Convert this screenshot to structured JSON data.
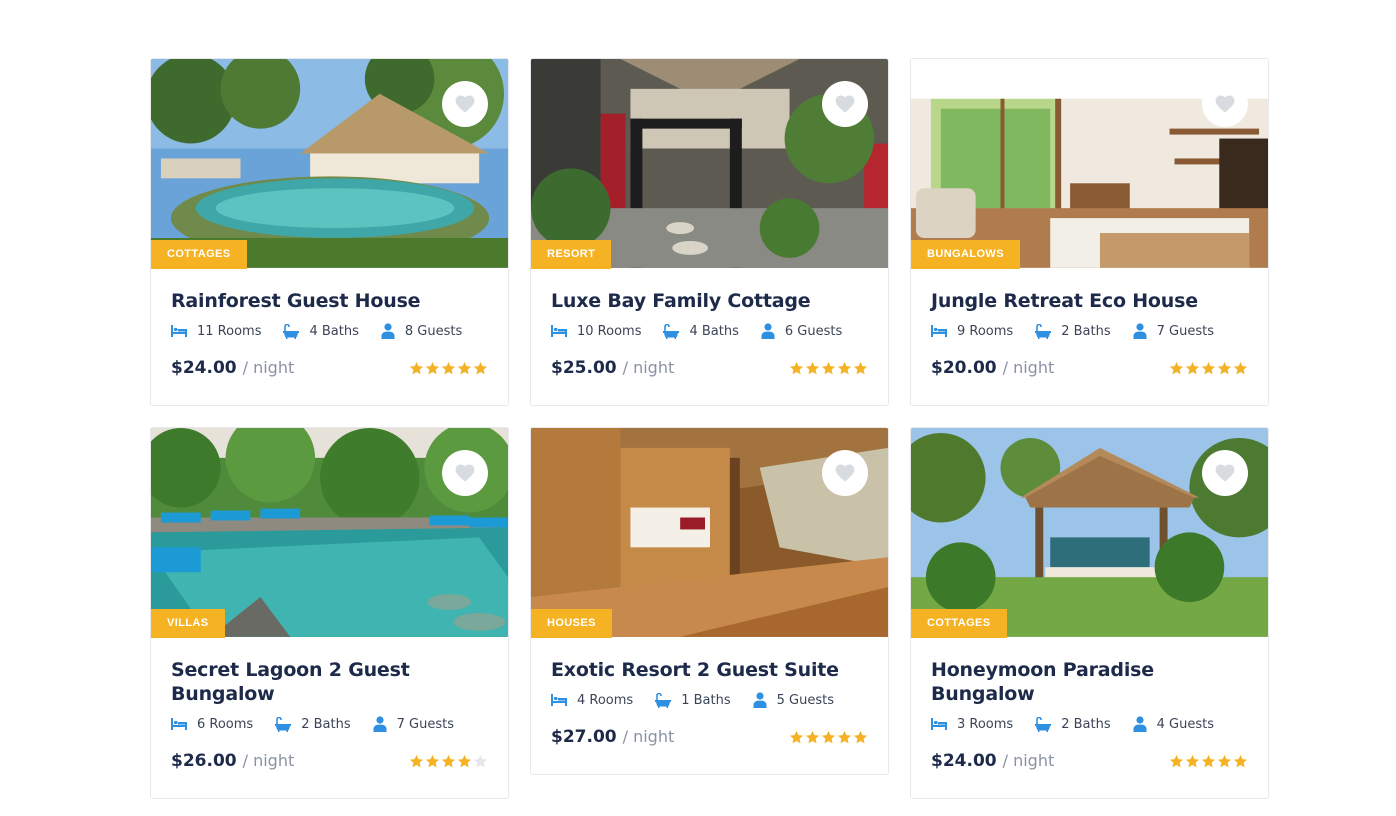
{
  "colors": {
    "accent": "#f5b324",
    "icon": "#2f8fe0",
    "title": "#1e2a4a"
  },
  "per_night_label": "/ night",
  "listings": [
    {
      "category": "COTTAGES",
      "title": "Rainforest Guest House",
      "rooms": "11 Rooms",
      "baths": "4 Baths",
      "guests": "8 Guests",
      "price": "$24.00",
      "rating": 5,
      "image": "resort pool with thatched villa"
    },
    {
      "category": "RESORT",
      "title": "Luxe Bay Family Cottage",
      "rooms": "10 Rooms",
      "baths": "4 Baths",
      "guests": "6 Guests",
      "price": "$25.00",
      "rating": 5,
      "image": "garden path with red doors"
    },
    {
      "category": "BUNGALOWS",
      "title": "Jungle Retreat Eco House",
      "rooms": "9 Rooms",
      "baths": "2 Baths",
      "guests": "7 Guests",
      "price": "$20.00",
      "rating": 5,
      "image": "bright bedroom interior"
    },
    {
      "category": "VILLAS",
      "title": "Secret Lagoon 2 Guest Bungalow",
      "rooms": "6 Rooms",
      "baths": "2 Baths",
      "guests": "7 Guests",
      "price": "$26.00",
      "rating": 4,
      "image": "tropical pool with blue loungers"
    },
    {
      "category": "HOUSES",
      "title": "Exotic Resort 2 Guest Suite",
      "rooms": "4 Rooms",
      "baths": "1 Baths",
      "guests": "5 Guests",
      "price": "$27.00",
      "rating": 5,
      "image": "wooden bamboo bungalow"
    },
    {
      "category": "COTTAGES",
      "title": "Honeymoon Paradise Bungalow",
      "rooms": "3 Rooms",
      "baths": "2 Baths",
      "guests": "4 Guests",
      "price": "$24.00",
      "rating": 5,
      "image": "garden gazebo with thatched roof"
    }
  ]
}
